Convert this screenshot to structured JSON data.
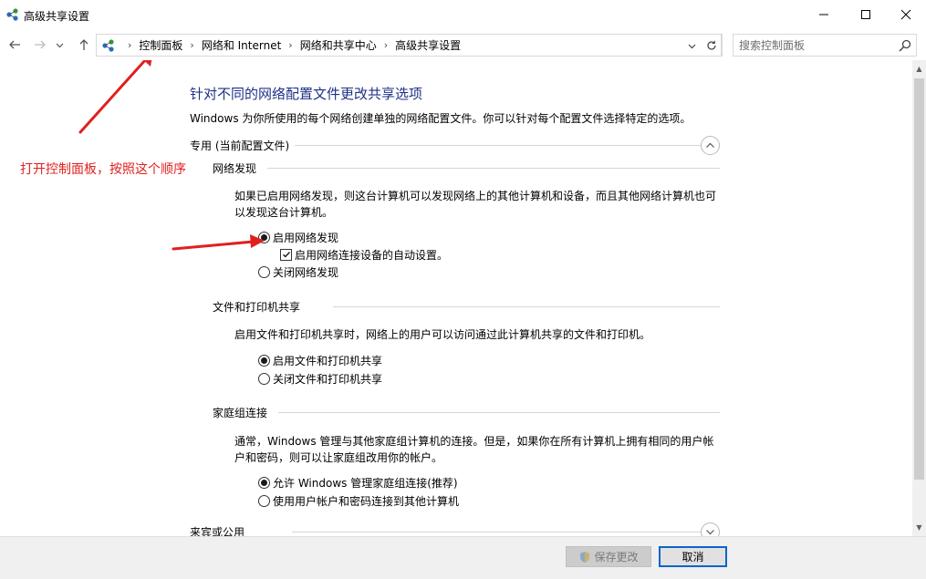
{
  "window": {
    "title": "高级共享设置",
    "icon": "network-sharing-icon"
  },
  "address": {
    "crumbs": [
      "控制面板",
      "网络和 Internet",
      "网络和共享中心",
      "高级共享设置"
    ],
    "search_placeholder": "搜索控制面板"
  },
  "page": {
    "title": "针对不同的网络配置文件更改共享选项",
    "intro": "Windows 为你所使用的每个网络创建单独的网络配置文件。你可以针对每个配置文件选择特定的选项。",
    "profile_private": "专用 (当前配置文件)",
    "profile_guest": "来宾或公用",
    "discovery": {
      "heading": "网络发现",
      "desc": "如果已启用网络发现，则这台计算机可以发现网络上的其他计算机和设备，而且其他网络计算机也可以发现这台计算机。",
      "on_label": "启用网络发现",
      "auto_label": "启用网络连接设备的自动设置。",
      "off_label": "关闭网络发现"
    },
    "file_print": {
      "heading": "文件和打印机共享",
      "desc": "启用文件和打印机共享时，网络上的用户可以访问通过此计算机共享的文件和打印机。",
      "on_label": "启用文件和打印机共享",
      "off_label": "关闭文件和打印机共享"
    },
    "homegroup": {
      "heading": "家庭组连接",
      "desc": "通常，Windows 管理与其他家庭组计算机的连接。但是，如果你在所有计算机上拥有相同的用户帐户和密码，则可以让家庭组改用你的帐户。",
      "allow_label": "允许 Windows 管理家庭组连接(推荐)",
      "user_label": "使用用户帐户和密码连接到其他计算机"
    }
  },
  "annotation": {
    "text": "打开控制面板，按照这个顺序",
    "color": "#e0201f"
  },
  "footer": {
    "save_label": "保存更改",
    "cancel_label": "取消"
  }
}
